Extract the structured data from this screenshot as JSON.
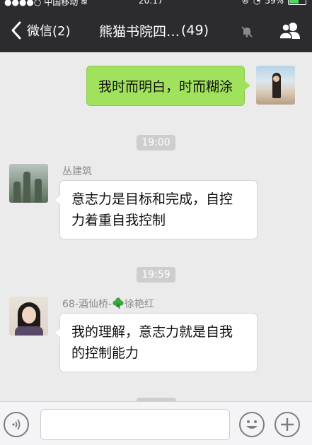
{
  "status_bar": {
    "signal": "●●●●○",
    "carrier": "中国移动",
    "time": "20:17",
    "battery": "59%",
    "battery_level": 0.59
  },
  "nav": {
    "back_label": "微信(2)",
    "title": "熊猫书院四…",
    "member_count": "(49)"
  },
  "messages": [
    {
      "side": "self",
      "text": "我时而明白，时而糊涂"
    },
    {
      "type": "time",
      "text": "19:00"
    },
    {
      "side": "other",
      "sender": "丛建筑",
      "text": "意志力是目标和完成，自控力着重自我控制"
    },
    {
      "type": "time",
      "text": "19:59"
    },
    {
      "side": "other",
      "sender_prefix": "68-酒仙桥-",
      "sender_suffix": "徐艳红",
      "text": "我的理解，意志力就是自我的控制能力"
    }
  ],
  "colors": {
    "nav_bg": "#2b2b30",
    "self_bubble": "#a1e25d",
    "chat_bg": "#ebebeb"
  },
  "icons": [
    "back-chevron-icon",
    "mute-icon",
    "group-members-icon",
    "voice-icon",
    "emoji-icon",
    "plus-icon",
    "clover-icon"
  ]
}
